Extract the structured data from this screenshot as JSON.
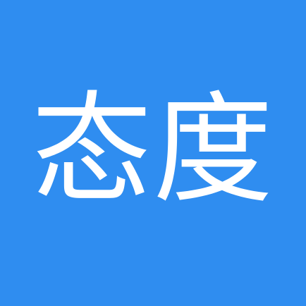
{
  "icon": {
    "text": "态度",
    "background_color": "#2f8df0",
    "text_color": "#ffffff"
  }
}
